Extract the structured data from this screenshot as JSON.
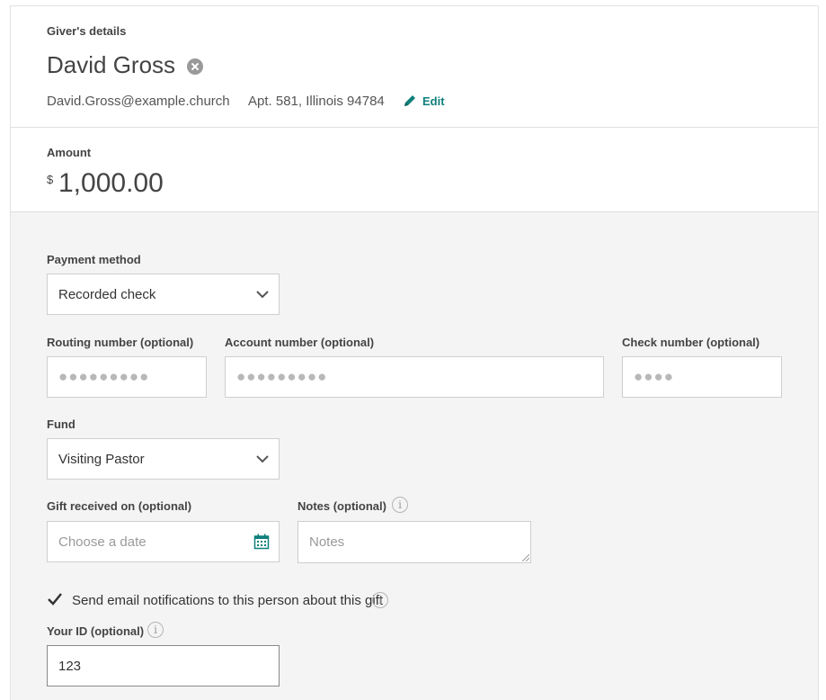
{
  "giver": {
    "section_label": "Giver's details",
    "name": "David Gross",
    "email": "David.Gross@example.church",
    "address": "Apt. 581, Illinois 94784",
    "edit_label": "Edit"
  },
  "amount": {
    "label": "Amount",
    "currency_symbol": "$",
    "value": "1,000.00"
  },
  "payment_method": {
    "label": "Payment method",
    "value": "Recorded check"
  },
  "routing": {
    "label": "Routing number (optional)",
    "value": "●●●●●●●●●"
  },
  "account": {
    "label": "Account number (optional)",
    "value": "●●●●●●●●●"
  },
  "check": {
    "label": "Check number (optional)",
    "value": "●●●●"
  },
  "fund": {
    "label": "Fund",
    "value": "Visiting Pastor"
  },
  "gift_received": {
    "label": "Gift received on (optional)",
    "placeholder": "Choose a date"
  },
  "notes": {
    "label": "Notes (optional)",
    "placeholder": "Notes"
  },
  "email_notify": {
    "label": "Send email notifications to this person about this gift",
    "checked": true
  },
  "your_id": {
    "label": "Your ID (optional)",
    "value": "123"
  },
  "icons": {
    "info": "i",
    "clear": "close-circle-icon",
    "edit": "pencil-icon",
    "calendar": "calendar-icon"
  },
  "colors": {
    "accent": "#0e7f7a",
    "panel_bg": "#f4f4f4",
    "border": "#cfcfcf"
  }
}
